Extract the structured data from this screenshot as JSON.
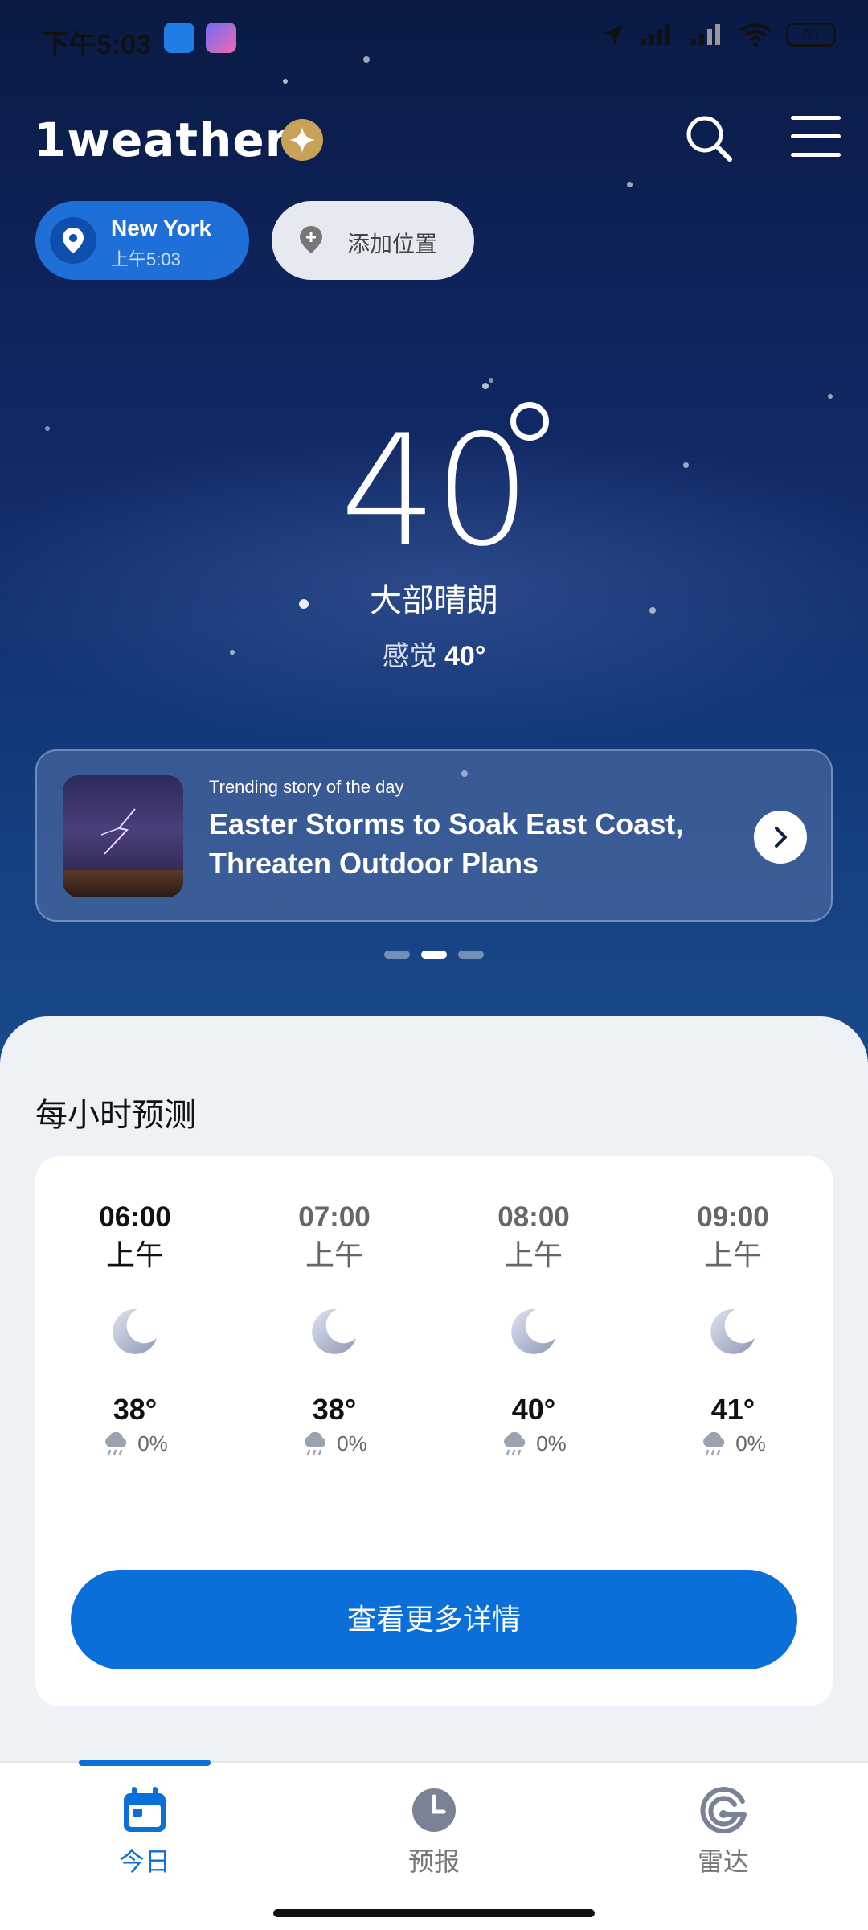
{
  "status_bar": {
    "time": "下午5:03",
    "battery": "99"
  },
  "header": {
    "logo_text": "1weather",
    "accent": "#c9a25a"
  },
  "locations": {
    "current": {
      "city": "New York",
      "local_time": "上午5:03"
    },
    "add_label": "添加位置"
  },
  "current": {
    "temperature": "40",
    "condition": "大部晴朗",
    "feels_like_label": "感觉",
    "feels_like_value": "40°"
  },
  "story": {
    "kicker": "Trending story of the day",
    "title": "Easter Storms to Soak East Coast, Threaten Outdoor Plans"
  },
  "carousel": {
    "count": 3,
    "active_index": 1
  },
  "hourly": {
    "title": "每小时预测",
    "hours": [
      {
        "time": "06:00",
        "ampm": "上午",
        "temp": "38°",
        "precip": "0%",
        "icon": "moon-icon"
      },
      {
        "time": "07:00",
        "ampm": "上午",
        "temp": "38°",
        "precip": "0%",
        "icon": "moon-icon"
      },
      {
        "time": "08:00",
        "ampm": "上午",
        "temp": "40°",
        "precip": "0%",
        "icon": "moon-icon"
      },
      {
        "time": "09:00",
        "ampm": "上午",
        "temp": "41°",
        "precip": "0%",
        "icon": "moon-icon"
      }
    ],
    "more_button": "查看更多详情"
  },
  "bottom_nav": {
    "items": [
      {
        "label": "今日",
        "icon": "calendar-icon",
        "active": true
      },
      {
        "label": "预报",
        "icon": "clock-icon",
        "active": false
      },
      {
        "label": "雷达",
        "icon": "radar-icon",
        "active": false
      }
    ]
  },
  "colors": {
    "primary": "#0a6fd8",
    "sky_top": "#0a1a44",
    "sheet_bg": "#eef2f6"
  }
}
